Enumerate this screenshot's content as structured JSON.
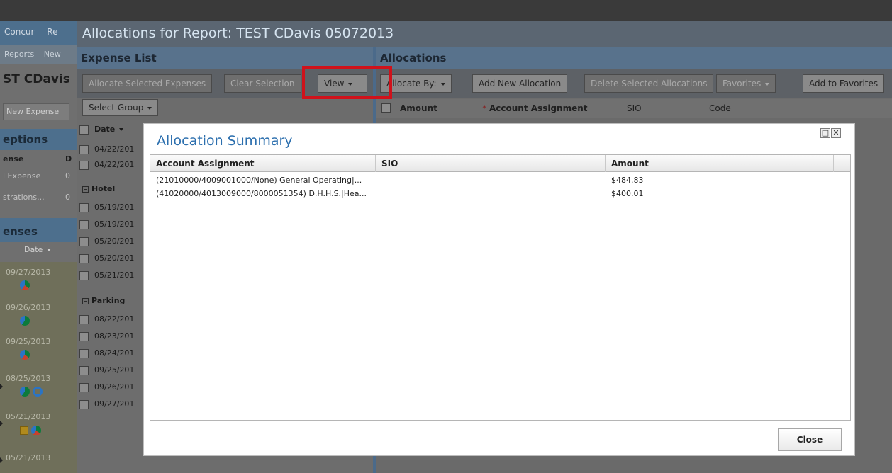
{
  "background_app": {
    "tabs": [
      "Concur",
      "Re"
    ],
    "subtabs": [
      "Reports",
      "New"
    ],
    "report_title_partial": "ST CDavis",
    "new_expense_button": "New Expense",
    "exceptions_header": "eptions",
    "exceptions_column": "ense",
    "exceptions_column_d": "D",
    "exception_rows": [
      {
        "label": "l Expense",
        "value": "0"
      },
      {
        "label": "strations...",
        "value": "0"
      }
    ],
    "expenses_header": "enses",
    "date_col": "Date",
    "expense_dates": [
      "09/27/2013",
      "09/26/2013",
      "09/25/2013",
      "08/25/2013",
      "05/21/2013",
      "05/21/2013"
    ]
  },
  "allocations_window": {
    "title": "Allocations for Report: TEST CDavis 05072013",
    "expense_list": {
      "header": "Expense List",
      "buttons": {
        "allocate_selected": "Allocate Selected Expenses",
        "clear_selection": "Clear Selection",
        "view": "View",
        "select_group": "Select Group"
      },
      "date_col": "Date",
      "rows_top": [
        "04/22/201",
        "04/22/201"
      ],
      "groups": [
        {
          "name": "Hotel",
          "rows": [
            "05/19/201",
            "05/19/201",
            "05/20/201",
            "05/20/201",
            "05/21/201"
          ]
        },
        {
          "name": "Parking",
          "rows": [
            "08/22/201",
            "08/23/201",
            "08/24/201",
            "09/25/201",
            "09/26/201",
            "09/27/201"
          ]
        }
      ]
    },
    "allocations": {
      "header": "Allocations",
      "buttons": {
        "allocate_by": "Allocate By:",
        "add_new": "Add New Allocation",
        "delete_selected": "Delete Selected Allocations",
        "favorites": "Favorites",
        "add_favorites": "Add to Favorites"
      },
      "columns": {
        "amount": "Amount",
        "required_marker": "*",
        "account_assignment": "Account Assignment",
        "sio": "SIO",
        "code": "Code"
      }
    }
  },
  "modal": {
    "title": "Allocation Summary",
    "maximize_glyph": "□",
    "close_glyph": "✕",
    "columns": [
      "Account Assignment",
      "SIO",
      "Amount"
    ],
    "rows": [
      {
        "account": "(21010000/4009001000/None) General Operating|...",
        "sio": "",
        "amount": "$484.83"
      },
      {
        "account": "(41020000/4013009000/8000051354) D.H.H.S.|Hea...",
        "sio": "",
        "amount": "$400.01"
      }
    ],
    "close_button": "Close"
  },
  "colors": {
    "highlight_border": "#d0121b",
    "modal_title": "#2c6fae"
  }
}
